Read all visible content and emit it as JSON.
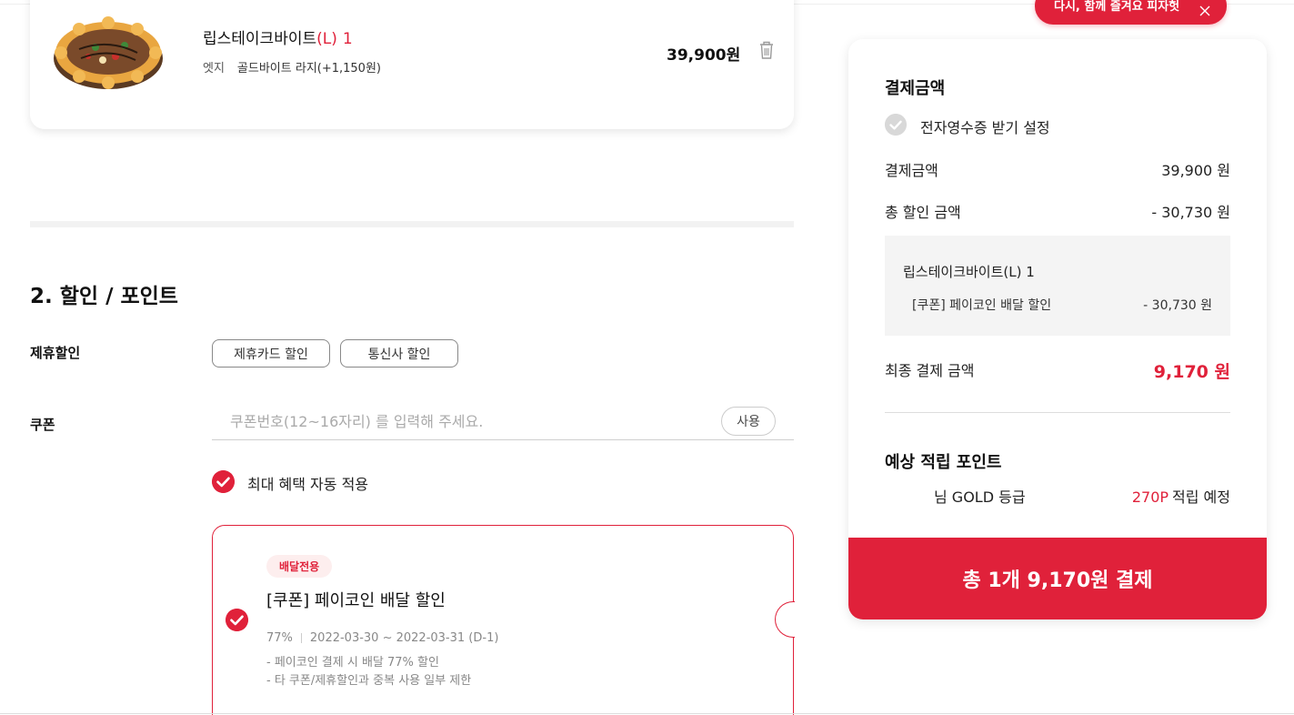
{
  "cart": {
    "item_name": "립스테이크바이트",
    "item_size": "(L)",
    "item_qty": "1",
    "option_label": "엣지",
    "option_value": "골드바이트 라지(+1,150원)",
    "price": "39,900원"
  },
  "discount_section": {
    "title": "2. 할인 / 포인트",
    "partner_label": "제휴할인",
    "card_discount_btn": "제휴카드 할인",
    "telecom_discount_btn": "통신사 할인",
    "coupon_label": "쿠폰",
    "coupon_placeholder": "쿠폰번호(12~16자리) 를 입력해 주세요.",
    "use_btn": "사용",
    "auto_apply_label": "최대 혜택 자동 적용"
  },
  "coupon": {
    "badge": "배달전용",
    "title": "[쿠폰] 페이코인 배달 할인",
    "rate": "77%",
    "period": "2022-03-30 ~ 2022-03-31 (D-1)",
    "desc_1": "- 페이코인 결제 시 배달 77% 할인",
    "desc_2": "- 타 쿠폰/제휴할인과 중복 사용 일부 제한"
  },
  "toast": {
    "text": "다시, 함께 즐겨요 피자헛"
  },
  "summary": {
    "title": "결제금액",
    "receipt_label": "전자영수증 받기 설정",
    "amount_label": "결제금액",
    "amount_value": "39,900 원",
    "discount_label": "총 할인 금액",
    "discount_value": "- 30,730 원",
    "detail_item": "립스테이크바이트(L) 1",
    "detail_coupon": "[쿠폰] 페이코인 배달 할인",
    "detail_coupon_value": "- 30,730 원",
    "final_label": "최종 결제 금액",
    "final_value": "9,170 원",
    "points_title": "예상 적립 포인트",
    "grade_label": "님 GOLD 등급",
    "points_value": "270P",
    "points_suffix": "적립 예정",
    "pay_button": "총 1개 9,170원 결제"
  },
  "colors": {
    "accent": "#e0213a",
    "muted_text": "#888888",
    "panel_bg": "#f4f4f4"
  }
}
